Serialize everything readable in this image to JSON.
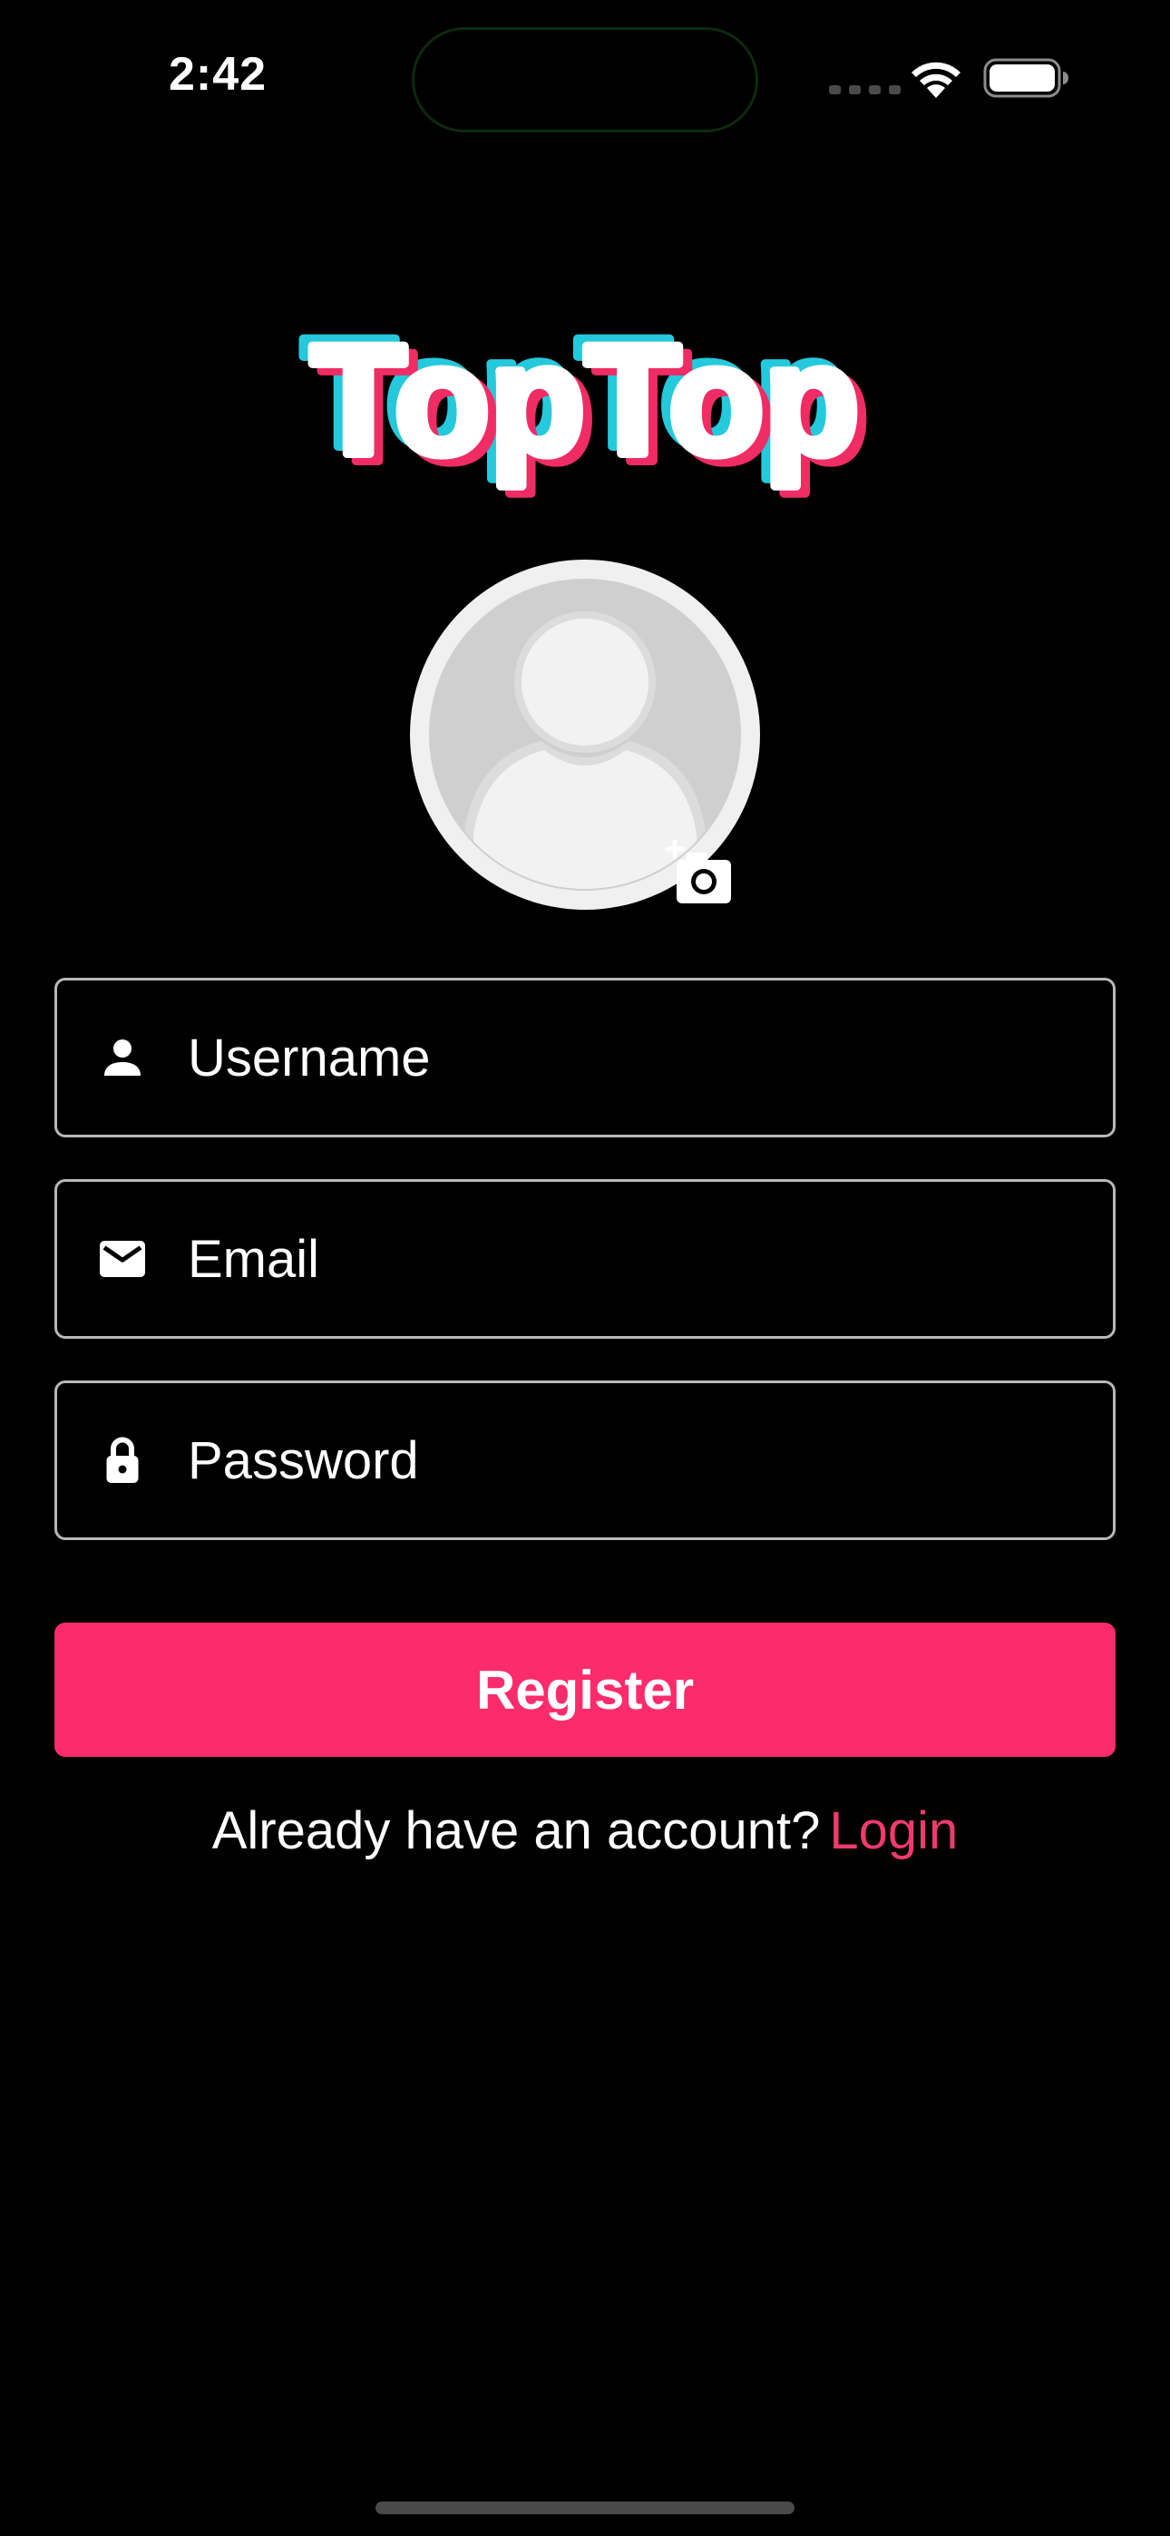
{
  "status_bar": {
    "time": "2:42",
    "icons": [
      "cellular-signal-icon",
      "wifi-icon",
      "battery-icon"
    ]
  },
  "logo": {
    "text": "TopTop",
    "colors": {
      "fill": "#ffffff",
      "shadow_cyan": "#25c9dc",
      "shadow_pink": "#f02c65"
    }
  },
  "avatar": {
    "icon": "default-user-avatar-icon",
    "add_photo_icon": "add-photo-camera-icon"
  },
  "form": {
    "username": {
      "icon": "person-icon",
      "placeholder": "Username",
      "value": ""
    },
    "email": {
      "icon": "mail-icon",
      "placeholder": "Email",
      "value": ""
    },
    "password": {
      "icon": "lock-icon",
      "placeholder": "Password",
      "value": ""
    },
    "register_label": "Register"
  },
  "login_prompt": {
    "text": "Already have an account?",
    "link_label": "Login"
  },
  "colors": {
    "background": "#000000",
    "accent": "#fc2c6c",
    "link": "#ef3a6e",
    "field_border": "#b8b8b8"
  }
}
